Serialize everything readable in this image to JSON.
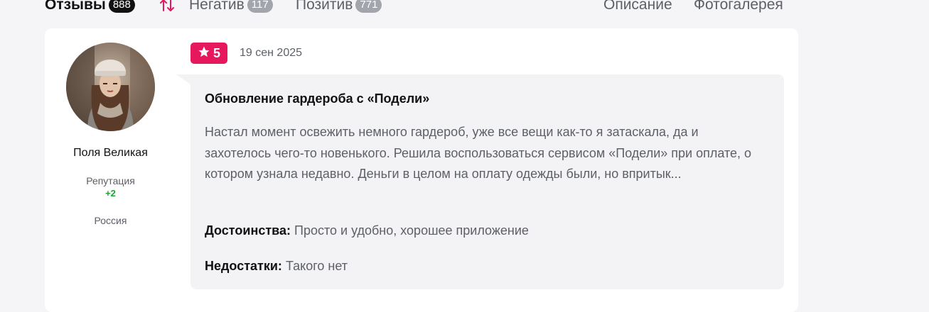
{
  "tabs": {
    "reviews": {
      "label": "Отзывы",
      "count": "888"
    },
    "negative": {
      "label": "Негатив",
      "count": "117"
    },
    "positive": {
      "label": "Позитив",
      "count": "771"
    },
    "description": "Описание",
    "gallery": "Фотогалерея"
  },
  "icons": {
    "sort": "sort-arrows-icon",
    "star": "star-icon"
  },
  "colors": {
    "accent": "#e6175c",
    "reputation": "#1aa532",
    "muted": "#5e6068",
    "count_badge": "#a3a5ad"
  },
  "review": {
    "author": {
      "name": "Поля Великая",
      "reputation_label": "Репутация",
      "reputation_value": "+2",
      "country": "Россия"
    },
    "rating": "5",
    "date": "19 сен 2025",
    "title": "Обновление гардероба с «Подели»",
    "text": "Настал момент освежить немного гардероб, уже все вещи как-то я затаскала, да и захотелось чего-то новенького. Решила воспользоваться сервисом «Подели» при оплате, о котором узнала недавно. Деньги в целом на оплату одежды были, но впритык...",
    "pros_label": "Достоинства:",
    "pros": "Просто и удобно, хорошее приложение",
    "cons_label": "Недостатки:",
    "cons": "Такого нет"
  }
}
